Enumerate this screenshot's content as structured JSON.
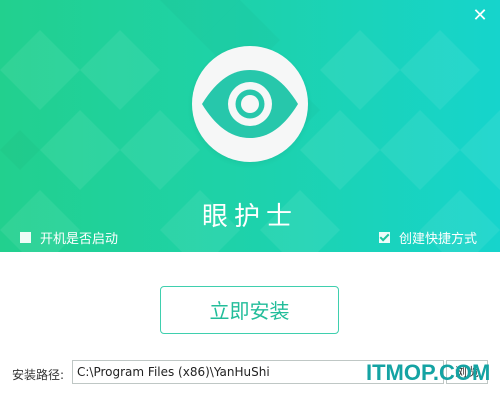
{
  "window": {
    "close_glyph": "✕"
  },
  "app": {
    "title": "眼护士"
  },
  "options": {
    "autostart": {
      "label": "开机是否启动",
      "checked": false
    },
    "shortcut": {
      "label": "创建快捷方式",
      "checked": true
    }
  },
  "install": {
    "button_label": "立即安装"
  },
  "path": {
    "label": "安装路径:",
    "value": "C:\\Program Files (x86)\\YanHuShi",
    "browse_label": "浏览"
  },
  "watermark": {
    "text": "ITMOP.COM"
  },
  "icons": {
    "logo": "eye-icon",
    "close": "close-icon"
  },
  "colors": {
    "banner_left": "#22d08e",
    "banner_right": "#16d4cc",
    "accent": "#22bd9a"
  }
}
